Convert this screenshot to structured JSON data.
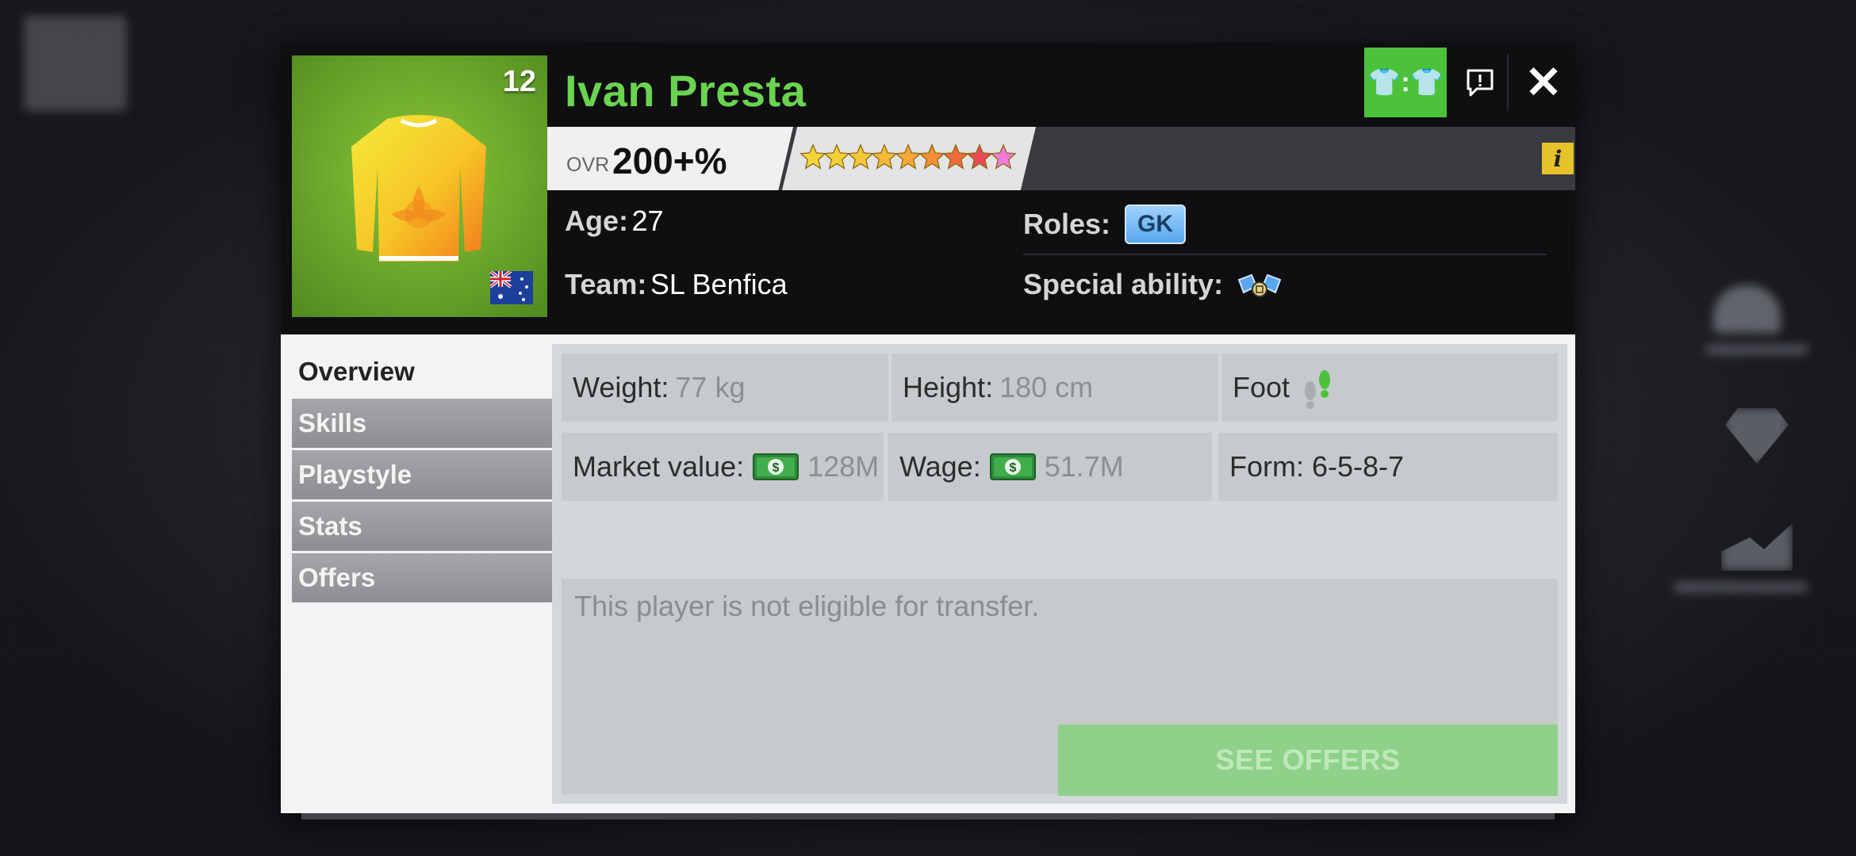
{
  "player": {
    "name": "Ivan Presta",
    "number": "12",
    "ovr_label": "OVR",
    "ovr_value": "200+%",
    "star_count": 9,
    "age_label": "Age:",
    "age": "27",
    "team_label": "Team:",
    "team": "SL Benfica",
    "roles_label": "Roles:",
    "role": "GK",
    "special_label": "Special ability:"
  },
  "header_buttons": {
    "compare_label": "👕:👕"
  },
  "icons": {
    "close": "✕",
    "info": "i"
  },
  "tabs": [
    {
      "label": "Overview",
      "active": true
    },
    {
      "label": "Skills",
      "active": false
    },
    {
      "label": "Playstyle",
      "active": false
    },
    {
      "label": "Stats",
      "active": false
    },
    {
      "label": "Offers",
      "active": false
    }
  ],
  "overview": {
    "weight_label": "Weight:",
    "weight": "77 kg",
    "height_label": "Height:",
    "height": "180 cm",
    "foot_label": "Foot",
    "market_label": "Market value:",
    "market_value": "128M",
    "wage_label": "Wage:",
    "wage": "51.7M",
    "form_label": "Form:",
    "form": "6-5-8-7"
  },
  "transfer": {
    "message": "This player is not eligible for transfer.",
    "see_offers": "SEE OFFERS"
  },
  "colors": {
    "accent_green": "#6ad34f",
    "button_green": "#4cc23a",
    "disabled_green": "#8fd18a",
    "info_yellow": "#e6c32a"
  }
}
